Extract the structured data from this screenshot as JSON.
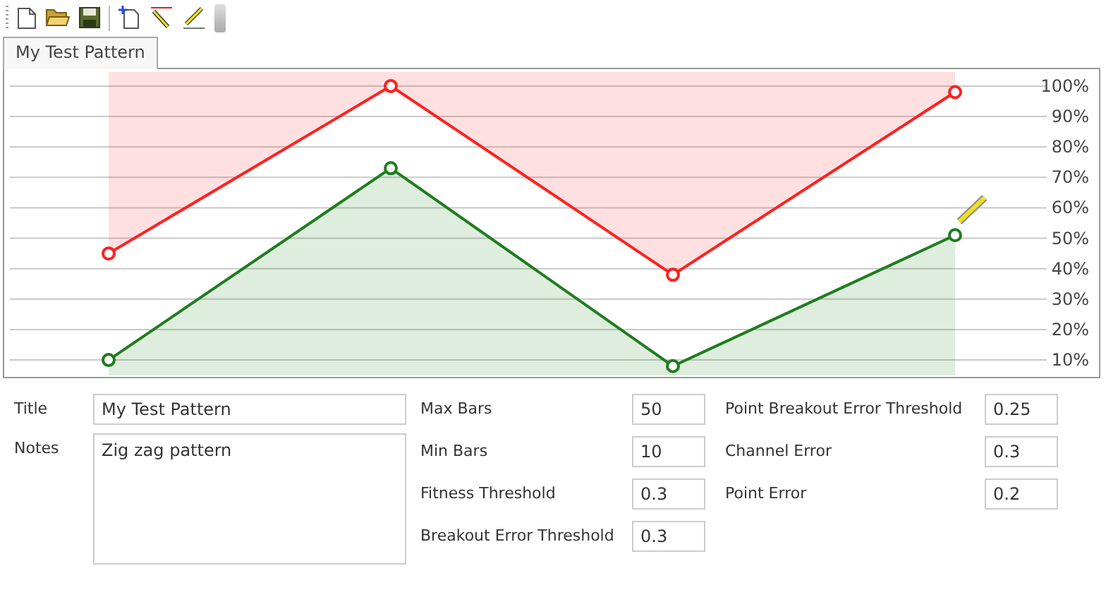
{
  "toolbar": {
    "buttons": [
      {
        "kind": "new"
      },
      {
        "kind": "open"
      },
      {
        "kind": "save"
      },
      {
        "kind": "separator"
      },
      {
        "kind": "add"
      },
      {
        "kind": "redline"
      },
      {
        "kind": "line"
      }
    ]
  },
  "tabs": [
    {
      "label": "My Test Pattern",
      "selected": true
    }
  ],
  "chart": {
    "chart_data": {
      "type": "line",
      "categories": [
        null,
        null,
        null,
        null
      ],
      "grid": true,
      "ylim": [
        4,
        106
      ],
      "yticks": [
        {
          "value": 10,
          "label": "10%"
        },
        {
          "value": 20,
          "label": "20%"
        },
        {
          "value": 30,
          "label": "30%"
        },
        {
          "value": 40,
          "label": "40%"
        },
        {
          "value": 50,
          "label": "50%"
        },
        {
          "value": 60,
          "label": "60%"
        },
        {
          "value": 70,
          "label": "70%"
        },
        {
          "value": 80,
          "label": "80%"
        },
        {
          "value": 90,
          "label": "90%"
        },
        {
          "value": 100,
          "label": "100%"
        }
      ],
      "series": [
        {
          "color": "#ff2020",
          "marker": "circle",
          "values": [
            45,
            100,
            38,
            98
          ]
        },
        {
          "color": "#1e7d1e",
          "marker": "circle",
          "values": [
            10,
            73,
            8,
            51
          ]
        }
      ]
    }
  },
  "form": {
    "title": {
      "label": "Title",
      "value": "My Test Pattern"
    },
    "notes": {
      "label": "Notes",
      "value": "Zig zag pattern"
    },
    "middle": [
      {
        "label": "Max Bars",
        "value": "50"
      },
      {
        "label": "Min Bars",
        "value": "10"
      },
      {
        "label": "Fitness Threshold",
        "value": "0.3"
      },
      {
        "label": "Breakout Error Threshold",
        "value": "0.3"
      }
    ],
    "right": [
      {
        "label": "Point Breakout Error Threshold",
        "value": "0.25"
      },
      {
        "label": "Channel Error",
        "value": "0.3"
      },
      {
        "label": "Point Error",
        "value": "0.2"
      }
    ]
  }
}
